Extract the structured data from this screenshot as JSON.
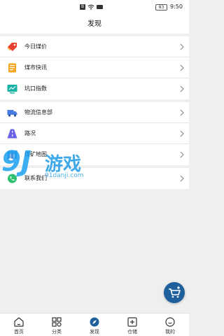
{
  "status_bar": {
    "battery": "83",
    "time": "9:50"
  },
  "header": {
    "title": "发现"
  },
  "groups": [
    {
      "items": [
        {
          "label": "今日煤价",
          "icon": "price-tag-icon"
        },
        {
          "label": "煤市快讯",
          "icon": "news-document-icon"
        },
        {
          "label": "坑口指数",
          "icon": "index-chart-icon"
        }
      ]
    },
    {
      "items": [
        {
          "label": "物流信息部",
          "icon": "truck-icon"
        },
        {
          "label": "路况",
          "icon": "road-icon"
        },
        {
          "label": "煤矿地图",
          "icon": "map-icon"
        }
      ]
    },
    {
      "items": [
        {
          "label": "联系我们",
          "icon": "contact-phone-icon"
        }
      ]
    }
  ],
  "watermark": {
    "number": "9J",
    "word": "游戏",
    "url": "91danji.com"
  },
  "fab": {
    "icon": "cart-icon"
  },
  "tabbar": {
    "items": [
      {
        "label": "首页",
        "icon": "home-icon",
        "active": false
      },
      {
        "label": "分类",
        "icon": "category-grid-icon",
        "active": false
      },
      {
        "label": "发现",
        "icon": "discover-compass-icon",
        "active": true
      },
      {
        "label": "仓储",
        "icon": "warehouse-icon",
        "active": false
      },
      {
        "label": "我的",
        "icon": "profile-smile-icon",
        "active": false
      }
    ]
  },
  "colors": {
    "accent": "#1f5f9c",
    "background": "#efefef"
  }
}
